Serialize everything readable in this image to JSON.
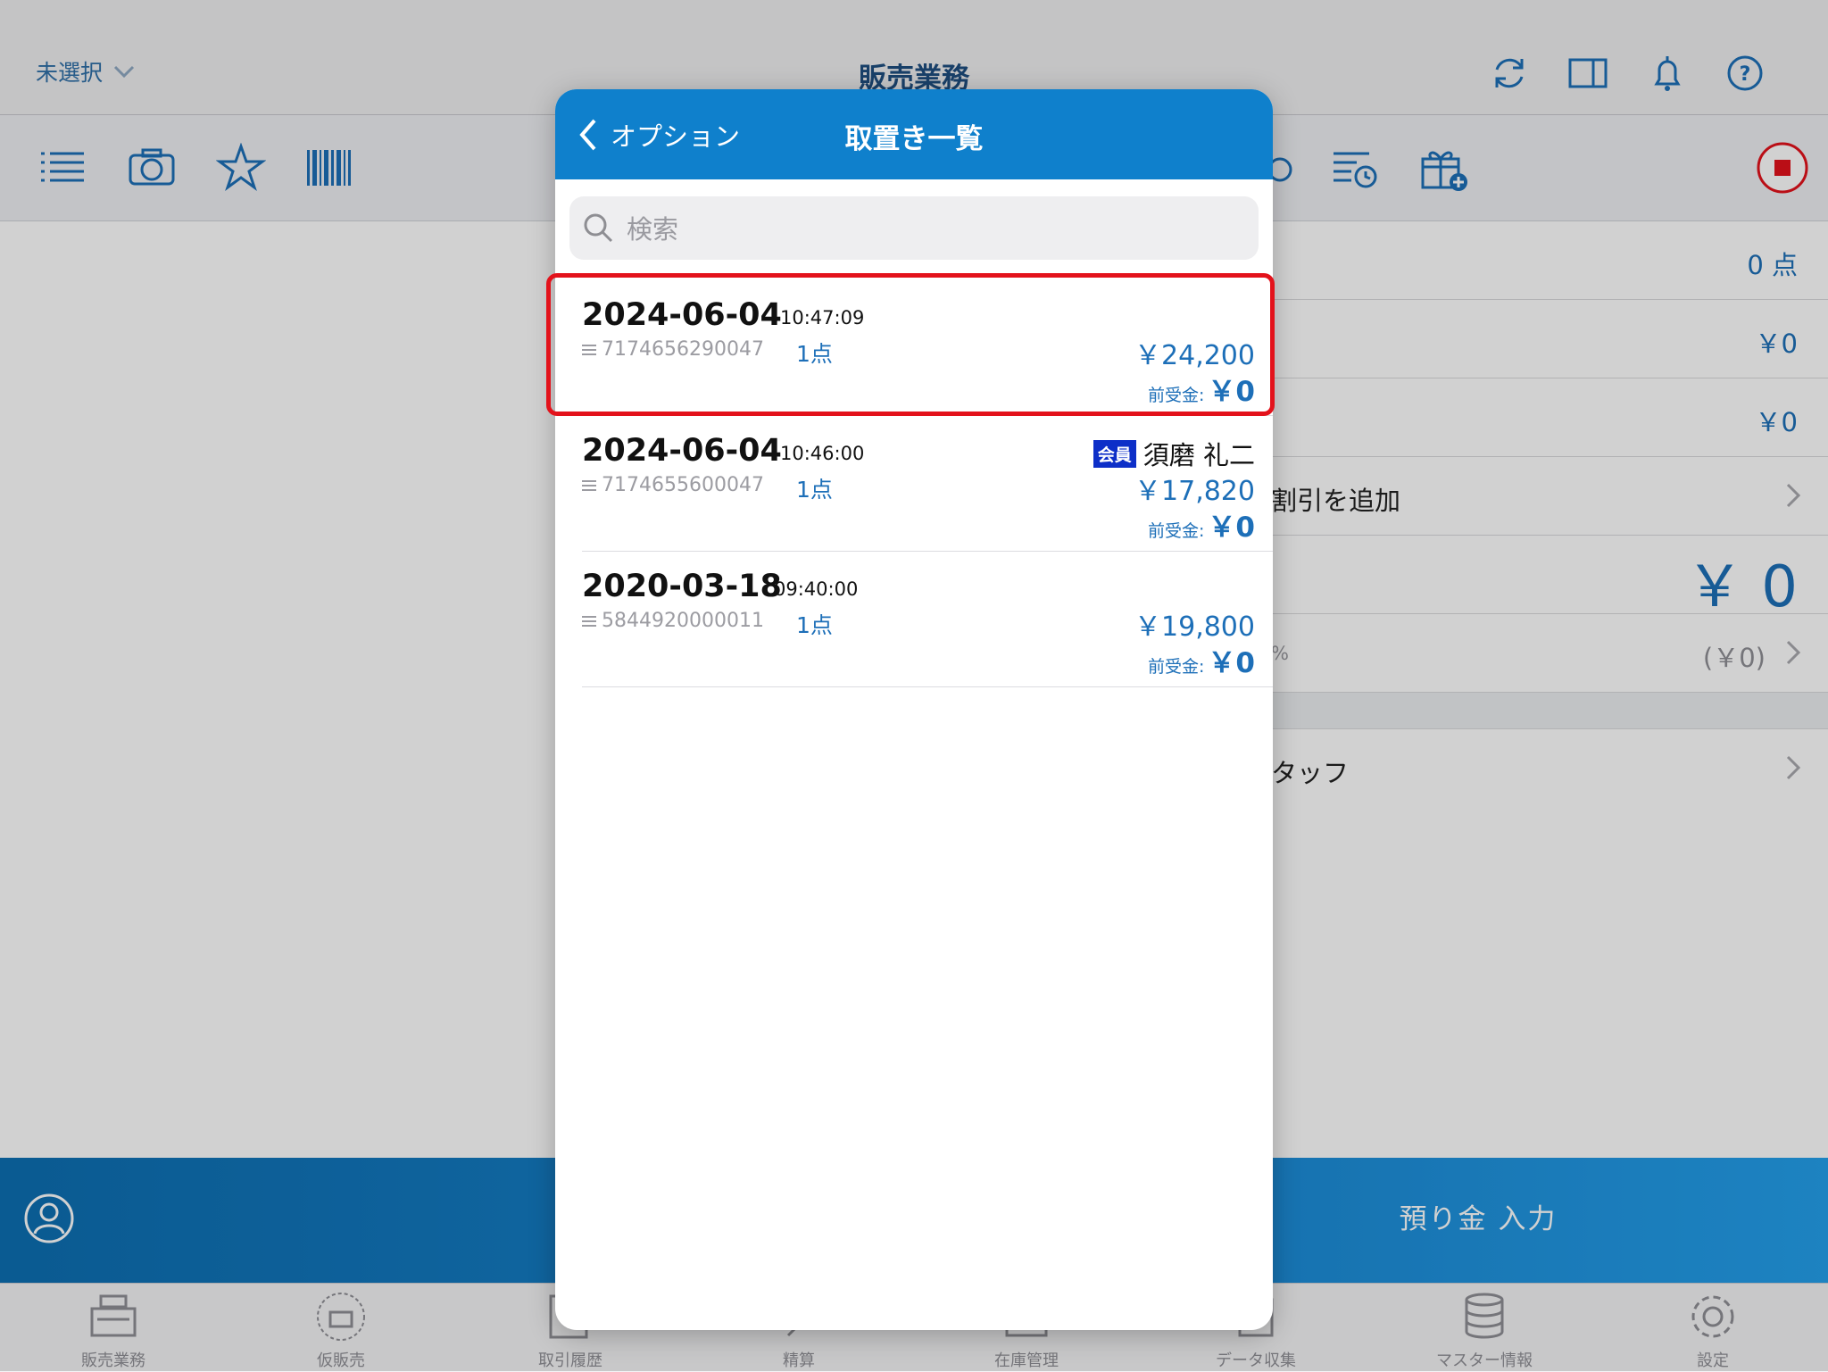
{
  "header": {
    "store_selector": "未選択",
    "title": "販売業務"
  },
  "summary": {
    "item_count": "0 点",
    "subtotal": "￥0",
    "discount": "￥0",
    "discount_row_label": "割引を追加",
    "total": "￥ 0",
    "tax_rate_label": "%",
    "tax": "(￥0)",
    "staff_label": "タッフ"
  },
  "actionbar": {
    "deposit_button": "預り金 入力"
  },
  "tabs": [
    {
      "label": "販売業務",
      "icon": "register-icon"
    },
    {
      "label": "仮販売",
      "icon": "temp-register-icon"
    },
    {
      "label": "取引履歴",
      "icon": "history-icon"
    },
    {
      "label": "精算",
      "icon": "settlement-icon"
    },
    {
      "label": "在庫管理",
      "icon": "inventory-icon"
    },
    {
      "label": "データ収集",
      "icon": "data-collect-icon"
    },
    {
      "label": "マスター情報",
      "icon": "database-icon"
    },
    {
      "label": "設定",
      "icon": "gear-icon"
    }
  ],
  "popover": {
    "back_label": "オプション",
    "title": "取置き一覧",
    "search_placeholder": "検索",
    "items": [
      {
        "date": "2024-06-04",
        "time": "10:47:09",
        "code": "7174656290047",
        "qty": "1点",
        "total": "￥24,200",
        "advance_label": "前受金:",
        "advance": "￥0",
        "member_badge": "",
        "member_name": ""
      },
      {
        "date": "2024-06-04",
        "time": "10:46:00",
        "code": "7174655600047",
        "qty": "1点",
        "total": "￥17,820",
        "advance_label": "前受金:",
        "advance": "￥0",
        "member_badge": "会員",
        "member_name": "須磨 礼二"
      },
      {
        "date": "2020-03-18",
        "time": "09:40:00",
        "code": "5844920000011",
        "qty": "1点",
        "total": "￥19,800",
        "advance_label": "前受金:",
        "advance": "￥0",
        "member_badge": "",
        "member_name": ""
      }
    ]
  },
  "colors": {
    "accent": "#0f80cc",
    "text_blue": "#1d6fb8",
    "highlight": "#e3121b",
    "member_badge": "#0d2fc8"
  }
}
